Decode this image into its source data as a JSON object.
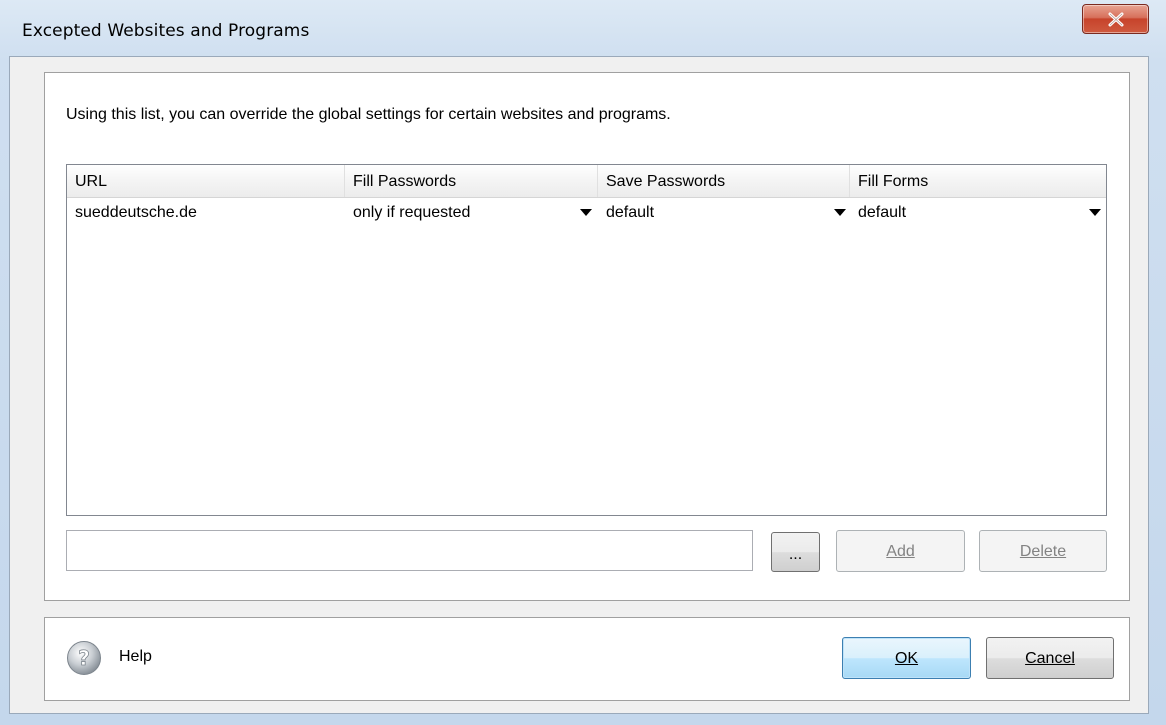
{
  "window": {
    "title": "Excepted Websites and Programs"
  },
  "description": "Using this list, you can override the global settings for certain websites and programs.",
  "list": {
    "columns": [
      "URL",
      "Fill Passwords",
      "Save Passwords",
      "Fill Forms"
    ],
    "rows": [
      {
        "url": "sueddeutsche.de",
        "fill_passwords": "only if requested",
        "save_passwords": "default",
        "fill_forms": "default"
      }
    ]
  },
  "input": {
    "value": "",
    "browse_label": "...",
    "add_label": "Add",
    "delete_label": "Delete"
  },
  "footer": {
    "help_label": "Help",
    "ok_label": "OK",
    "cancel_label": "Cancel"
  },
  "colors": {
    "close_button": "#c7432b",
    "default_button_border": "#3c7fb1",
    "frame": "#c4d7ec"
  },
  "icons": {
    "close": "close-icon",
    "help": "help-icon",
    "dropdown": "chevron-down-icon"
  }
}
